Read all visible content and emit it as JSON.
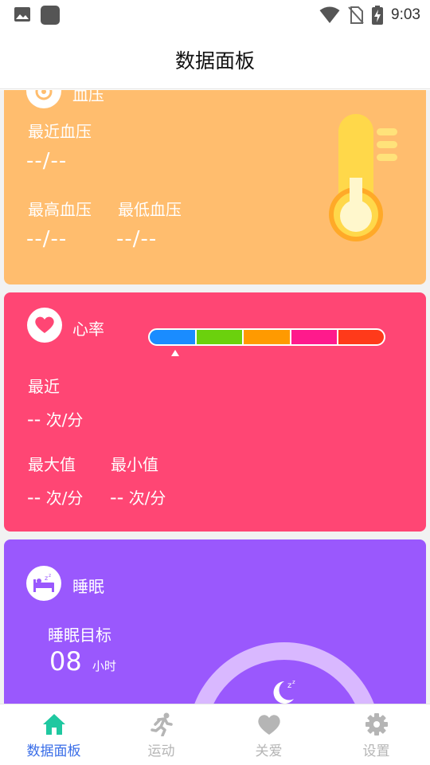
{
  "status_bar": {
    "time": "9:03",
    "icons": [
      "image-icon",
      "app-square-icon",
      "wifi-icon",
      "no-sim-icon",
      "battery-charging-icon"
    ]
  },
  "header": {
    "title": "数据面板"
  },
  "blood_pressure": {
    "title": "血压",
    "icon": "blood-pressure-icon",
    "recent_label": "最近血压",
    "recent_value": "--/--",
    "max_label": "最高血压",
    "max_value": "--/--",
    "min_label": "最低血压",
    "min_value": "--/--",
    "colors": {
      "card": "#ffbd6e",
      "thermometer": "#ffd84a"
    }
  },
  "heart_rate": {
    "title": "心率",
    "icon": "heart-icon",
    "recent_label": "最近",
    "recent_value": "--",
    "unit": "次/分",
    "max_label": "最大值",
    "max_value": "--",
    "min_label": "最小值",
    "min_value": "--",
    "scale_colors": [
      "#1a8cff",
      "#6bd10d",
      "#ff9a00",
      "#ff1a8c",
      "#ff3a1a"
    ],
    "colors": {
      "card": "#ff4674"
    }
  },
  "sleep": {
    "title": "睡眠",
    "icon": "bed-icon",
    "goal_label": "睡眠目标",
    "goal_value": "08",
    "goal_unit": "小时",
    "colors": {
      "card": "#9a58fd",
      "arc": "#d9b8ff"
    }
  },
  "bottom_nav": {
    "items": [
      {
        "label": "数据面板",
        "icon": "home-icon",
        "active": true
      },
      {
        "label": "运动",
        "icon": "running-icon",
        "active": false
      },
      {
        "label": "关爱",
        "icon": "heart-icon",
        "active": false
      },
      {
        "label": "设置",
        "icon": "gear-icon",
        "active": false
      }
    ],
    "colors": {
      "active": "#3a6ee8",
      "active_icon": "#1fc8a0",
      "inactive": "#b5b5b5"
    }
  }
}
